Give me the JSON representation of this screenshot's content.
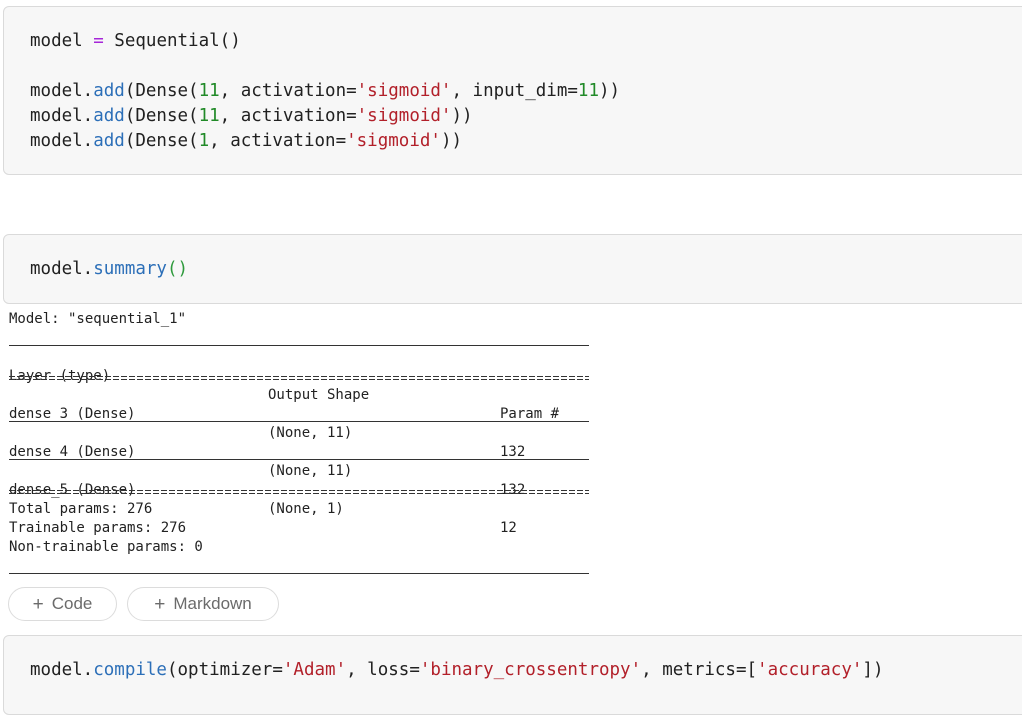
{
  "cells": {
    "cell1": {
      "line1": {
        "a": "model ",
        "b": "=",
        "c": " Sequential()"
      },
      "line2": {
        "a": "model.",
        "fn": "add",
        "b": "(Dense(",
        "n1": "11",
        "c": ", activation=",
        "s": "'sigmoid'",
        "d": ", input_dim=",
        "n2": "11",
        "e": "))"
      },
      "line3": {
        "a": "model.",
        "fn": "add",
        "b": "(Dense(",
        "n1": "11",
        "c": ", activation=",
        "s": "'sigmoid'",
        "e": "))"
      },
      "line4": {
        "a": "model.",
        "fn": "add",
        "b": "(Dense(",
        "n1": "1",
        "c": ", activation=",
        "s": "'sigmoid'",
        "e": "))"
      }
    },
    "cell2": {
      "line1": {
        "a": "model.",
        "fn": "summary",
        "p": "()"
      }
    },
    "cell3": {
      "line1": {
        "a": "model.",
        "fn": "compile",
        "b": "(optimizer=",
        "s1": "'Adam'",
        "c": ", loss=",
        "s2": "'binary_crossentropy'",
        "d": ", metrics=[",
        "s3": "'accuracy'",
        "e": "])"
      }
    }
  },
  "summary_output": {
    "model_line": "Model: \"sequential_1\"",
    "headers": [
      "Layer (type)",
      "Output Shape",
      "Param #"
    ],
    "rows": [
      {
        "layer": "dense_3 (Dense)",
        "shape": "(None, 11)",
        "params": "132"
      },
      {
        "layer": "dense_4 (Dense)",
        "shape": "(None, 11)",
        "params": "132"
      },
      {
        "layer": "dense_5 (Dense)",
        "shape": "(None, 1)",
        "params": "12"
      }
    ],
    "total": "Total params: 276",
    "trainable": "Trainable params: 276",
    "non_trainable": "Non-trainable params: 0"
  },
  "toolbar": {
    "add_code_label": "Code",
    "add_markdown_label": "Markdown",
    "plus_glyph": "+"
  },
  "colors": {
    "operator": "#a626d8",
    "function": "#2c6fb8",
    "number": "#218a28",
    "string": "#b2202a"
  }
}
